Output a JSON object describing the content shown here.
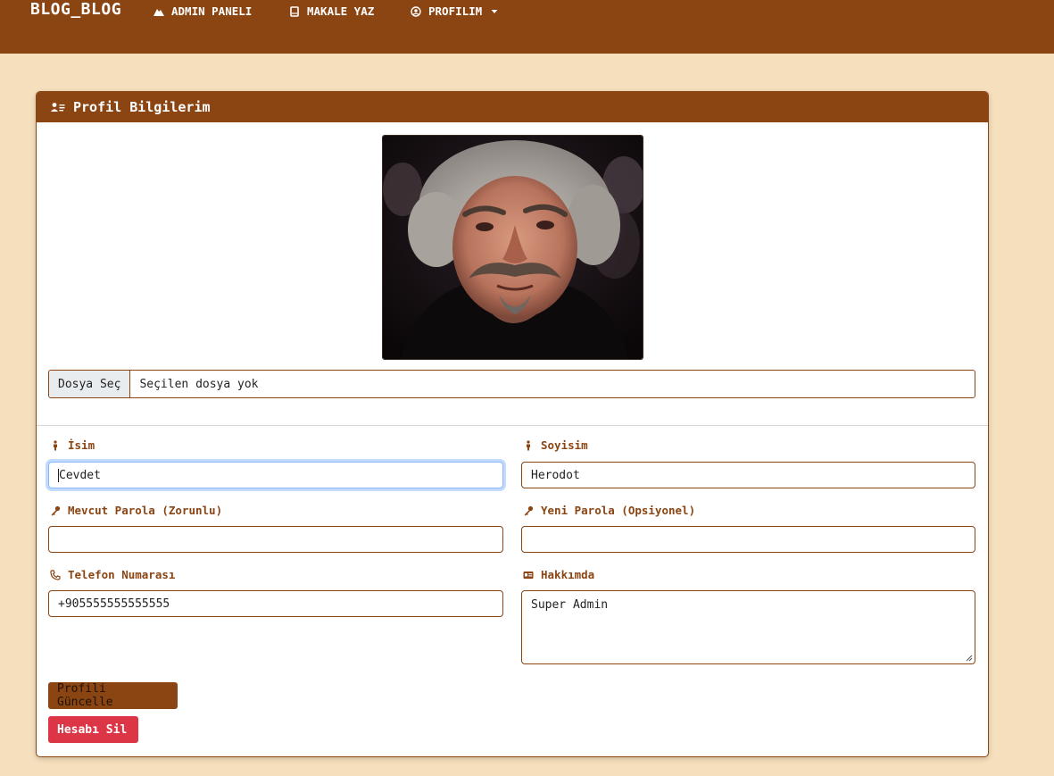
{
  "navbar": {
    "brand": "BLOG_BLOG",
    "items": [
      {
        "label": "ADMIN PANELI",
        "icon": "mountain-icon"
      },
      {
        "label": "MAKALE YAZ",
        "icon": "book-icon"
      },
      {
        "label": "PROFILIM",
        "icon": "user-circle-icon"
      }
    ]
  },
  "card": {
    "title": "Profil Bilgilerim",
    "avatar_alt": "profile photo"
  },
  "file_input": {
    "button": "Dosya Seç",
    "status": "Seçilen dosya yok"
  },
  "form": {
    "first_name": {
      "label": "İsim",
      "value": "Cevdet"
    },
    "last_name": {
      "label": "Soyisim",
      "value": "Herodot"
    },
    "current_password": {
      "label": "Mevcut Parola (Zorunlu)",
      "value": ""
    },
    "new_password": {
      "label": "Yeni Parola (Opsiyonel)",
      "value": ""
    },
    "phone": {
      "label": "Telefon Numarası",
      "value": "+905555555555555"
    },
    "about": {
      "label": "Hakkımda",
      "value": "Super Admin"
    }
  },
  "buttons": {
    "update": "Profili Güncelle",
    "delete": "Hesabı Sil"
  },
  "colors": {
    "primary": "#8b4513",
    "background": "#f5dfbc",
    "danger": "#dc3545"
  }
}
